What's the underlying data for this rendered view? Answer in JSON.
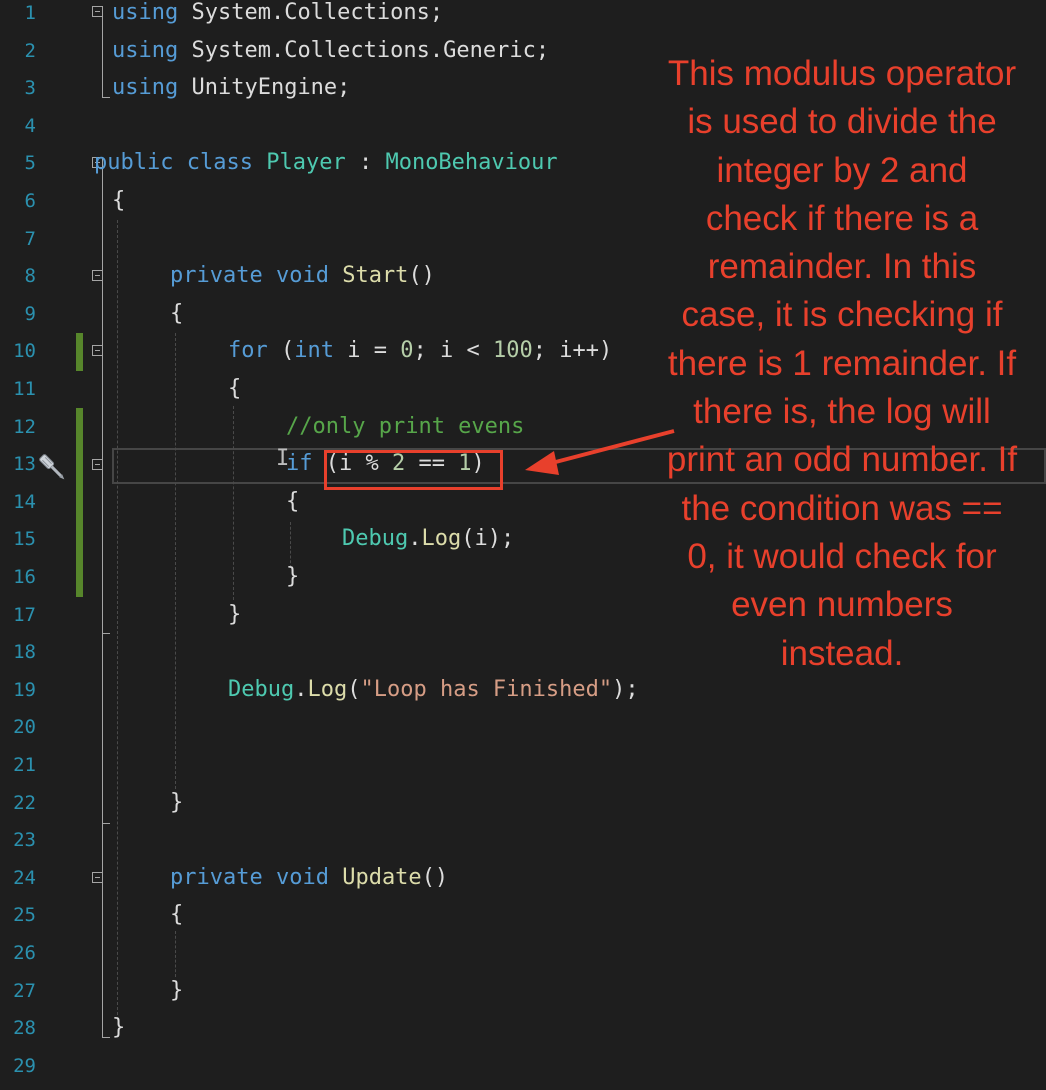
{
  "editor": {
    "lines": [
      {
        "n": "1",
        "tokens": [
          {
            "t": "using",
            "c": "kw"
          },
          {
            "t": " System.Collections;"
          }
        ]
      },
      {
        "n": "2",
        "tokens": [
          {
            "t": "using",
            "c": "kw"
          },
          {
            "t": " System.Collections.Generic;"
          }
        ]
      },
      {
        "n": "3",
        "tokens": [
          {
            "t": "using",
            "c": "kw"
          },
          {
            "t": " UnityEngine;"
          }
        ]
      },
      {
        "n": "4",
        "tokens": []
      },
      {
        "n": "5",
        "tokens": [
          {
            "t": "public",
            "c": "kw"
          },
          {
            "t": " "
          },
          {
            "t": "class",
            "c": "kw"
          },
          {
            "t": " "
          },
          {
            "t": "Player",
            "c": "ty"
          },
          {
            "t": " : "
          },
          {
            "t": "MonoBehaviour",
            "c": "ty"
          }
        ]
      },
      {
        "n": "6",
        "tokens": [
          {
            "t": "{"
          }
        ]
      },
      {
        "n": "7",
        "tokens": []
      },
      {
        "n": "8",
        "tokens": [
          {
            "t": "private",
            "c": "kw"
          },
          {
            "t": " "
          },
          {
            "t": "void",
            "c": "kw"
          },
          {
            "t": " "
          },
          {
            "t": "Start",
            "c": "fn"
          },
          {
            "t": "()"
          }
        ]
      },
      {
        "n": "9",
        "tokens": [
          {
            "t": "{"
          }
        ]
      },
      {
        "n": "10",
        "tokens": [
          {
            "t": "for",
            "c": "kw"
          },
          {
            "t": " ("
          },
          {
            "t": "int",
            "c": "kw"
          },
          {
            "t": " i = "
          },
          {
            "t": "0",
            "c": "nu"
          },
          {
            "t": "; i < "
          },
          {
            "t": "100",
            "c": "nu"
          },
          {
            "t": "; i++)"
          }
        ]
      },
      {
        "n": "11",
        "tokens": [
          {
            "t": "{"
          }
        ]
      },
      {
        "n": "12",
        "tokens": [
          {
            "t": "//only print evens",
            "c": "cm"
          }
        ]
      },
      {
        "n": "13",
        "tokens": [
          {
            "t": "if",
            "c": "kw"
          },
          {
            "t": " (i % "
          },
          {
            "t": "2",
            "c": "nu"
          },
          {
            "t": " == "
          },
          {
            "t": "1",
            "c": "nu"
          },
          {
            "t": ")"
          }
        ]
      },
      {
        "n": "14",
        "tokens": [
          {
            "t": "{"
          }
        ]
      },
      {
        "n": "15",
        "tokens": [
          {
            "t": "Debug",
            "c": "ty"
          },
          {
            "t": "."
          },
          {
            "t": "Log",
            "c": "fn"
          },
          {
            "t": "(i);"
          }
        ]
      },
      {
        "n": "16",
        "tokens": [
          {
            "t": "}"
          }
        ]
      },
      {
        "n": "17",
        "tokens": [
          {
            "t": "}"
          }
        ]
      },
      {
        "n": "18",
        "tokens": []
      },
      {
        "n": "19",
        "tokens": [
          {
            "t": "Debug",
            "c": "ty"
          },
          {
            "t": "."
          },
          {
            "t": "Log",
            "c": "fn"
          },
          {
            "t": "("
          },
          {
            "t": "\"Loop has Finished\"",
            "c": "st"
          },
          {
            "t": ");"
          }
        ]
      },
      {
        "n": "20",
        "tokens": []
      },
      {
        "n": "21",
        "tokens": []
      },
      {
        "n": "22",
        "tokens": [
          {
            "t": "}"
          }
        ]
      },
      {
        "n": "23",
        "tokens": []
      },
      {
        "n": "24",
        "tokens": [
          {
            "t": "private",
            "c": "kw"
          },
          {
            "t": " "
          },
          {
            "t": "void",
            "c": "kw"
          },
          {
            "t": " "
          },
          {
            "t": "Update",
            "c": "fn"
          },
          {
            "t": "()"
          }
        ]
      },
      {
        "n": "25",
        "tokens": [
          {
            "t": "{"
          }
        ]
      },
      {
        "n": "26",
        "tokens": []
      },
      {
        "n": "27",
        "tokens": [
          {
            "t": "}"
          }
        ]
      },
      {
        "n": "28",
        "tokens": [
          {
            "t": "}"
          }
        ]
      },
      {
        "n": "29",
        "tokens": []
      }
    ],
    "current_line": "13",
    "lightbulb_icon": "screwdriver-icon"
  },
  "annotation": {
    "text": "This modulus operator is used to divide the integer by 2 and check if there is a remainder. In this case, it is checking if there is 1 remainder. If there is, the log will print an odd number. If the condition was == 0, it would check for even numbers instead.",
    "color": "#e8402c"
  },
  "colors": {
    "background": "#1e1e1e",
    "keyword": "#569cd6",
    "type": "#4ec9b0",
    "method": "#dcdcaa",
    "string": "#d69d85",
    "comment": "#57a64a",
    "line_number": "#2b91af",
    "change_bar": "#57862b"
  }
}
